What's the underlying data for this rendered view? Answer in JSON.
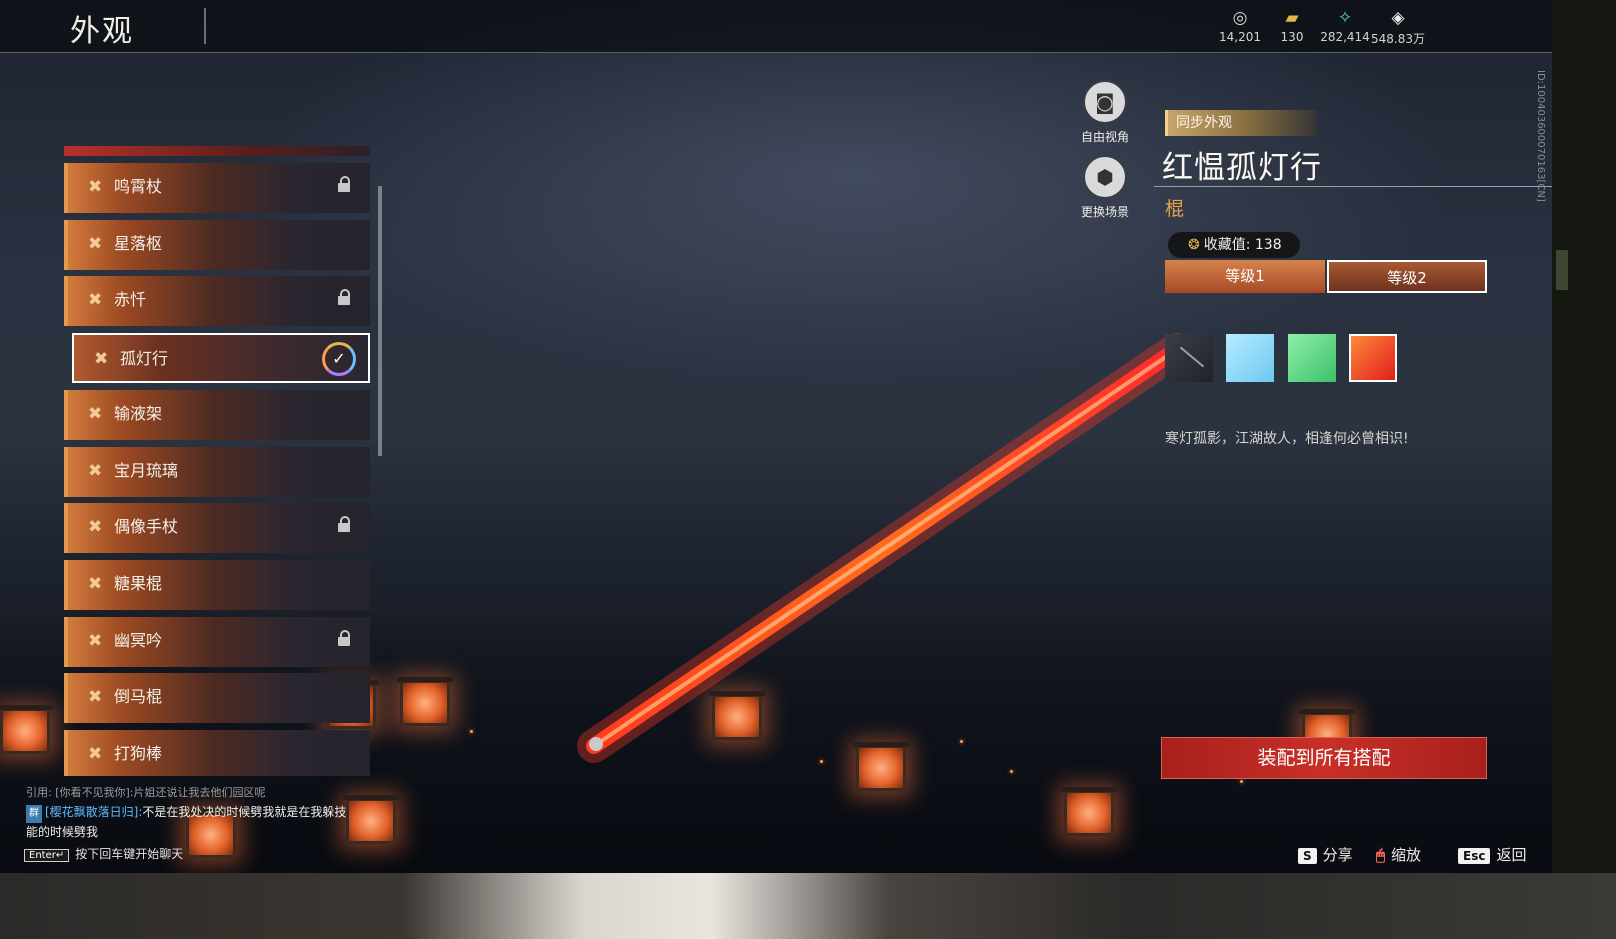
{
  "page": {
    "title": "外观"
  },
  "currencies": [
    {
      "icon": "coins-icon",
      "glyph": "◎",
      "value": "14,201"
    },
    {
      "icon": "ticket-icon",
      "glyph": "▰",
      "value": "130"
    },
    {
      "icon": "feather-icon",
      "glyph": "✧",
      "value": "282,414"
    },
    {
      "icon": "diamond-icon",
      "glyph": "◈",
      "value": "548.83万"
    }
  ],
  "side_id": "ID:10040360007016​3[CN]",
  "list": {
    "items": [
      {
        "label": "鸣霄杖",
        "locked": true,
        "selected": false
      },
      {
        "label": "星落枢",
        "locked": false,
        "selected": false
      },
      {
        "label": "赤忏",
        "locked": true,
        "selected": false
      },
      {
        "label": "孤灯行",
        "locked": false,
        "selected": true
      },
      {
        "label": "输液架",
        "locked": false,
        "selected": false
      },
      {
        "label": "宝月琉璃",
        "locked": false,
        "selected": false
      },
      {
        "label": "偶像手杖",
        "locked": true,
        "selected": false
      },
      {
        "label": "糖果棍",
        "locked": false,
        "selected": false
      },
      {
        "label": "幽冥吟",
        "locked": true,
        "selected": false
      },
      {
        "label": "倒马棍",
        "locked": false,
        "selected": false
      },
      {
        "label": "打狗棒",
        "locked": false,
        "selected": false
      }
    ]
  },
  "tools": {
    "free_view": "自由视角",
    "change_scene": "更换场景"
  },
  "detail": {
    "sync_tag": "同步外观",
    "title": "红愠孤灯行",
    "category": "棍",
    "collect_label": "收藏值: 138",
    "tabs": [
      "等级1",
      "等级2"
    ],
    "active_tab": 1,
    "description": "寒灯孤影，江湖故人，相逢何必曾相识!",
    "equip_button": "装配到所有搭配",
    "swatches": [
      "#000000",
      "#9fe3ff",
      "#5fdc88",
      "#f05028"
    ]
  },
  "chat": {
    "quote": "引用: [你看不见我你]:片姐还说让我去他们园区呢",
    "tag": "群",
    "nick": "[樱花飘散落日归]:",
    "message": "不是在我处决的时候劈我就是在我躲技能的时候劈我",
    "hint_key": "Enter↵",
    "hint": "按下回车键开始聊天"
  },
  "hotkeys": [
    {
      "key": "S",
      "label": "分享"
    },
    {
      "key": "🖱",
      "label": "缩放"
    },
    {
      "key": "Esc",
      "label": "返回"
    }
  ]
}
